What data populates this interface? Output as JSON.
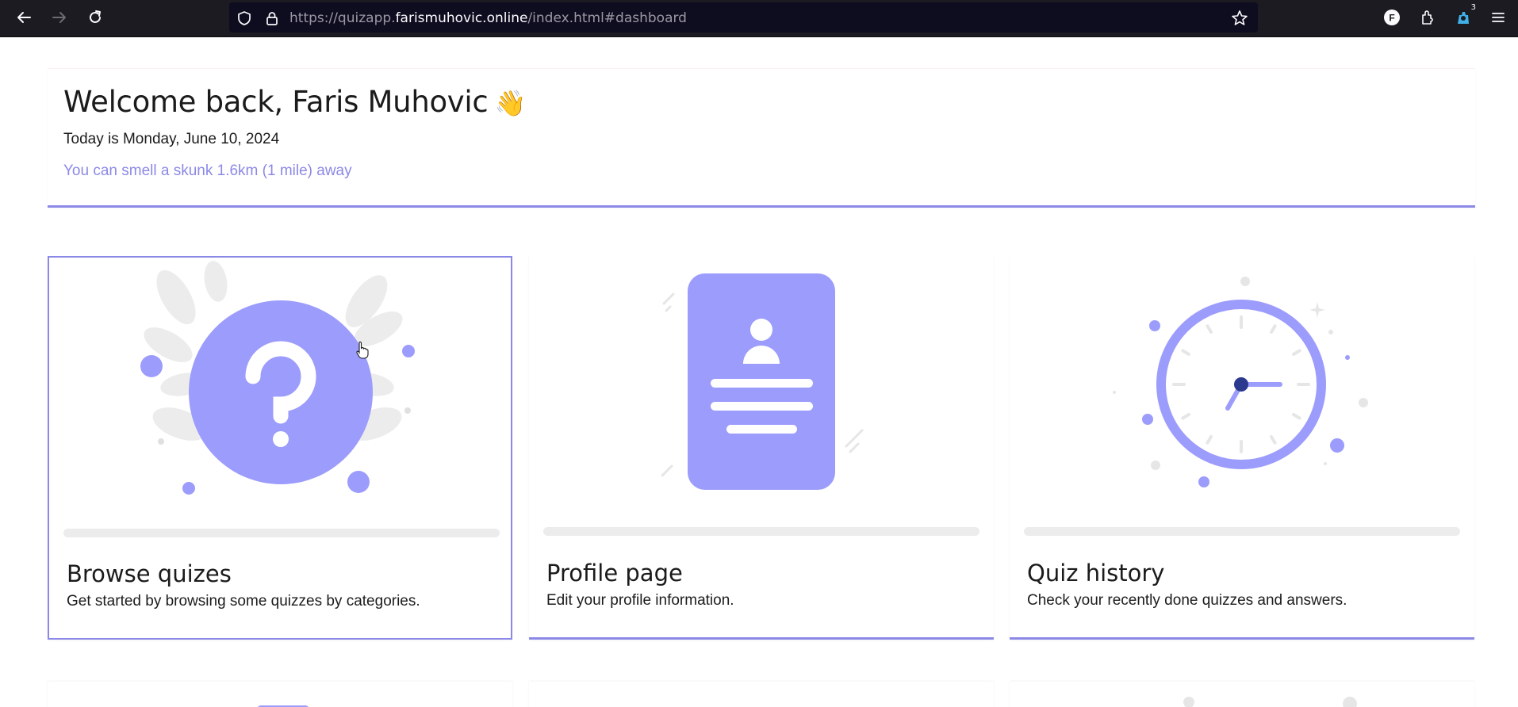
{
  "browser": {
    "url_prefix": "https://quizapp.",
    "url_host": "farismuhovic.online",
    "url_path": "/index.html#dashboard",
    "extension_badge": "3",
    "icons": [
      "back-arrow-icon",
      "forward-arrow-icon",
      "reload-icon",
      "shield-icon",
      "lock-icon",
      "bookmark-star-icon",
      "account-icon",
      "extensions-icon",
      "tracker-icon",
      "menu-icon"
    ]
  },
  "welcome": {
    "title": "Welcome back, Faris Muhovic",
    "emoji": "👋",
    "today": "Today is Monday, June 10, 2024",
    "fact": "You can smell a skunk 1.6km (1 mile) away"
  },
  "cards": [
    {
      "title": "Browse quizes",
      "description": "Get started by browsing some quizzes by categories.",
      "icon": "question-icon"
    },
    {
      "title": "Profile page",
      "description": "Edit your profile information.",
      "icon": "profile-card-icon"
    },
    {
      "title": "Quiz history",
      "description": "Check your recently done quizzes and answers.",
      "icon": "clock-icon"
    }
  ],
  "colors": {
    "accent": "#8c89e6",
    "illustration": "#9c9cfc",
    "illustration_dark": "#2b3a8e",
    "leaf_gray": "#ececec",
    "browser_bg": "#1c1b22",
    "urlbar_bg": "#0e0c1f"
  }
}
